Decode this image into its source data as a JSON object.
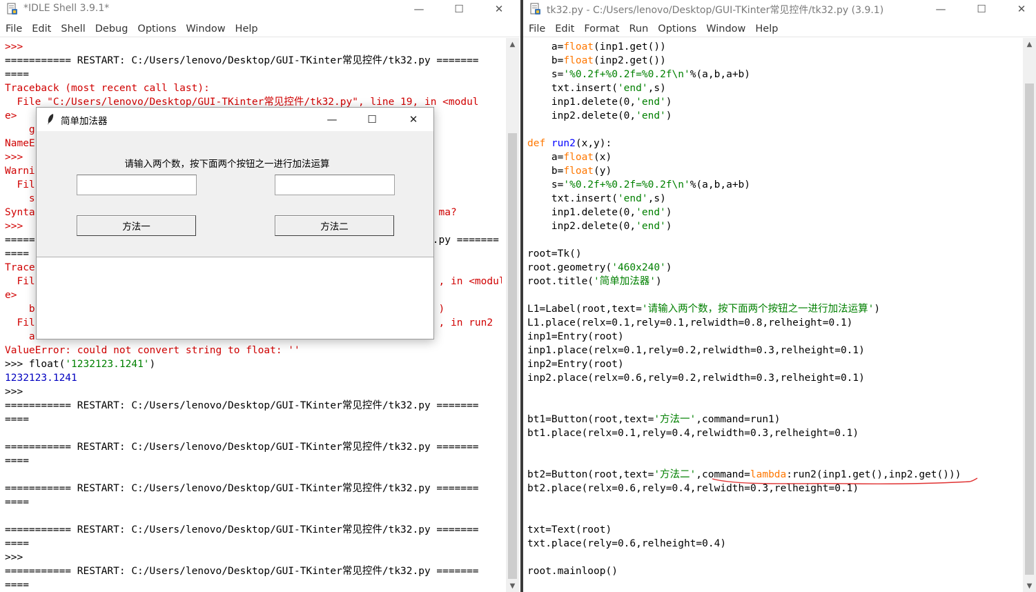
{
  "shell_window": {
    "title": "*IDLE Shell 3.9.1*",
    "menu": [
      "File",
      "Edit",
      "Shell",
      "Debug",
      "Options",
      "Window",
      "Help"
    ],
    "lines": [
      [
        {
          "t": ">>>",
          "c": "err"
        }
      ],
      [
        {
          "t": "=========== RESTART: C:/Users/lenovo/Desktop/GUI-TKinter常见控件/tk32.py ======="
        }
      ],
      [
        {
          "t": "===="
        }
      ],
      [
        {
          "t": "Traceback (most recent call last):",
          "c": "err"
        }
      ],
      [
        {
          "t": "  File \"C:/Users/lenovo/Desktop/GUI-TKinter常见控件/tk32.py\", line 19, in <modul",
          "c": "err"
        }
      ],
      [
        {
          "t": "e>",
          "c": "err"
        }
      ],
      [
        {
          "t": "    g",
          "c": "err"
        }
      ],
      [
        {
          "t": "NameE",
          "c": "err"
        }
      ],
      [
        {
          "t": ">>>",
          "c": "err"
        }
      ],
      [
        {
          "t": "Warni",
          "c": "err"
        }
      ],
      [
        {
          "t": "  Fil",
          "c": "err"
        }
      ],
      [
        {
          "t": "    s",
          "c": "err"
        }
      ],
      [
        {
          "t": "Synta",
          "c": "err"
        },
        {
          "t": "                                                                   ma?",
          "c": "err"
        }
      ],
      [
        {
          "t": ">>>",
          "c": "err"
        }
      ],
      [
        {
          "t": "=====                                                                  .py ======="
        }
      ],
      [
        {
          "t": "===="
        }
      ],
      [
        {
          "t": "Trace",
          "c": "err"
        }
      ],
      [
        {
          "t": "  Fil",
          "c": "err"
        },
        {
          "t": "                                                                   , in <modul",
          "c": "err"
        }
      ],
      [
        {
          "t": "e>",
          "c": "err"
        }
      ],
      [
        {
          "t": "    b",
          "c": "err"
        },
        {
          "t": "                                                                   )",
          "c": "err"
        }
      ],
      [
        {
          "t": "  Fil",
          "c": "err"
        },
        {
          "t": "                                                                   , in run2",
          "c": "err"
        }
      ],
      [
        {
          "t": "    a",
          "c": "err"
        }
      ],
      [
        {
          "t": "ValueError: could not convert string to float: ''",
          "c": "err"
        }
      ],
      [
        {
          "t": ">>> "
        },
        {
          "t": "float("
        },
        {
          "t": "'1232123.1241'",
          "c": "str"
        },
        {
          "t": ")"
        }
      ],
      [
        {
          "t": "1232123.1241",
          "c": "out"
        }
      ],
      [
        {
          "t": ">>>"
        }
      ],
      [
        {
          "t": "=========== RESTART: C:/Users/lenovo/Desktop/GUI-TKinter常见控件/tk32.py ======="
        }
      ],
      [
        {
          "t": "===="
        }
      ],
      [
        {
          "t": ""
        }
      ],
      [
        {
          "t": "=========== RESTART: C:/Users/lenovo/Desktop/GUI-TKinter常见控件/tk32.py ======="
        }
      ],
      [
        {
          "t": "===="
        }
      ],
      [
        {
          "t": ""
        }
      ],
      [
        {
          "t": "=========== RESTART: C:/Users/lenovo/Desktop/GUI-TKinter常见控件/tk32.py ======="
        }
      ],
      [
        {
          "t": "===="
        }
      ],
      [
        {
          "t": ""
        }
      ],
      [
        {
          "t": "=========== RESTART: C:/Users/lenovo/Desktop/GUI-TKinter常见控件/tk32.py ======="
        }
      ],
      [
        {
          "t": "===="
        }
      ],
      [
        {
          "t": ">>>"
        }
      ],
      [
        {
          "t": "=========== RESTART: C:/Users/lenovo/Desktop/GUI-TKinter常见控件/tk32.py ======="
        }
      ],
      [
        {
          "t": "===="
        }
      ]
    ]
  },
  "editor_window": {
    "title": "tk32.py - C:/Users/lenovo/Desktop/GUI-TKinter常见控件/tk32.py (3.9.1)",
    "menu": [
      "File",
      "Edit",
      "Format",
      "Run",
      "Options",
      "Window",
      "Help"
    ],
    "lines": [
      [
        {
          "t": "    a="
        },
        {
          "t": "float",
          "c": "kw"
        },
        {
          "t": "(inp1.get())"
        }
      ],
      [
        {
          "t": "    b="
        },
        {
          "t": "float",
          "c": "kw"
        },
        {
          "t": "(inp2.get())"
        }
      ],
      [
        {
          "t": "    s="
        },
        {
          "t": "'%0.2f+%0.2f=%0.2f\\n'",
          "c": "str"
        },
        {
          "t": "%(a,b,a+b)"
        }
      ],
      [
        {
          "t": "    txt.insert("
        },
        {
          "t": "'end'",
          "c": "str"
        },
        {
          "t": ",s)"
        }
      ],
      [
        {
          "t": "    inp1.delete(0,"
        },
        {
          "t": "'end'",
          "c": "str"
        },
        {
          "t": ")"
        }
      ],
      [
        {
          "t": "    inp2.delete(0,"
        },
        {
          "t": "'end'",
          "c": "str"
        },
        {
          "t": ")"
        }
      ],
      [
        {
          "t": ""
        }
      ],
      [
        {
          "t": "def",
          "c": "kw"
        },
        {
          "t": " "
        },
        {
          "t": "run2",
          "c": "def"
        },
        {
          "t": "(x,y):"
        }
      ],
      [
        {
          "t": "    a="
        },
        {
          "t": "float",
          "c": "kw"
        },
        {
          "t": "(x)"
        }
      ],
      [
        {
          "t": "    b="
        },
        {
          "t": "float",
          "c": "kw"
        },
        {
          "t": "(y)"
        }
      ],
      [
        {
          "t": "    s="
        },
        {
          "t": "'%0.2f+%0.2f=%0.2f\\n'",
          "c": "str"
        },
        {
          "t": "%(a,b,a+b)"
        }
      ],
      [
        {
          "t": "    txt.insert("
        },
        {
          "t": "'end'",
          "c": "str"
        },
        {
          "t": ",s)"
        }
      ],
      [
        {
          "t": "    inp1.delete(0,"
        },
        {
          "t": "'end'",
          "c": "str"
        },
        {
          "t": ")"
        }
      ],
      [
        {
          "t": "    inp2.delete(0,"
        },
        {
          "t": "'end'",
          "c": "str"
        },
        {
          "t": ")"
        }
      ],
      [
        {
          "t": ""
        }
      ],
      [
        {
          "t": "root=Tk()"
        }
      ],
      [
        {
          "t": "root.geometry("
        },
        {
          "t": "'460x240'",
          "c": "str"
        },
        {
          "t": ")"
        }
      ],
      [
        {
          "t": "root.title("
        },
        {
          "t": "'简单加法器'",
          "c": "str"
        },
        {
          "t": ")"
        }
      ],
      [
        {
          "t": ""
        }
      ],
      [
        {
          "t": "L1=Label(root,text="
        },
        {
          "t": "'请输入两个数，按下面两个按钮之一进行加法运算'",
          "c": "str"
        },
        {
          "t": ")"
        }
      ],
      [
        {
          "t": "L1.place(relx=0.1,rely=0.1,relwidth=0.8,relheight=0.1)"
        }
      ],
      [
        {
          "t": "inp1=Entry(root)"
        }
      ],
      [
        {
          "t": "inp1.place(relx=0.1,rely=0.2,relwidth=0.3,relheight=0.1)"
        }
      ],
      [
        {
          "t": "inp2=Entry(root)"
        }
      ],
      [
        {
          "t": "inp2.place(relx=0.6,rely=0.2,relwidth=0.3,relheight=0.1)"
        }
      ],
      [
        {
          "t": ""
        }
      ],
      [
        {
          "t": ""
        }
      ],
      [
        {
          "t": "bt1=Button(root,text="
        },
        {
          "t": "'方法一'",
          "c": "str"
        },
        {
          "t": ",command=run1)"
        }
      ],
      [
        {
          "t": "bt1.place(relx=0.1,rely=0.4,relwidth=0.3,relheight=0.1)"
        }
      ],
      [
        {
          "t": ""
        }
      ],
      [
        {
          "t": ""
        }
      ],
      [
        {
          "t": "bt2=Button(root,text="
        },
        {
          "t": "'方法二'",
          "c": "str"
        },
        {
          "t": ",command="
        },
        {
          "t": "lambda",
          "c": "kw"
        },
        {
          "t": ":run2(inp1.get(),inp2.get()))"
        }
      ],
      [
        {
          "t": "bt2.place(relx=0.6,rely=0.4,relwidth=0.3,relheight=0.1)"
        }
      ],
      [
        {
          "t": ""
        }
      ],
      [
        {
          "t": ""
        }
      ],
      [
        {
          "t": "txt=Text(root)"
        }
      ],
      [
        {
          "t": "txt.place(rely=0.6,relheight=0.4)"
        }
      ],
      [
        {
          "t": ""
        }
      ],
      [
        {
          "t": "root.mainloop()"
        }
      ]
    ]
  },
  "tk_dialog": {
    "title": "简单加法器",
    "label": "请输入两个数，按下面两个按钮之一进行加法运算",
    "entry1_value": "",
    "entry2_value": "",
    "button1": "方法一",
    "button2": "方法二",
    "text_content": ""
  },
  "window_controls": {
    "minimize": "—",
    "maximize": "☐",
    "close": "✕"
  },
  "colors": {
    "error": "#d00000",
    "string": "#008000",
    "keyword": "#ff7700",
    "definition": "#0000ff",
    "output": "#0000c0",
    "annotation": "#e03030"
  }
}
